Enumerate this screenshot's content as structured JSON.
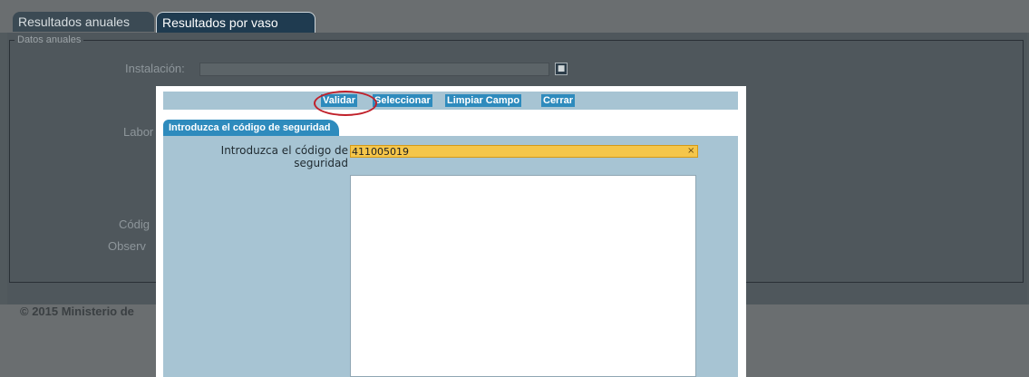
{
  "tabs": [
    {
      "label": "Resultados anuales",
      "active": false
    },
    {
      "label": "Resultados por vaso",
      "active": true
    }
  ],
  "form": {
    "legend": "Datos anuales",
    "labels": {
      "instalacion": "Instalación:",
      "laboratorio": "Labor",
      "codigo": "Códig",
      "observaciones": "Observ"
    },
    "instalacion_value": ""
  },
  "footer": {
    "text": "© 2015 Ministerio de"
  },
  "modal": {
    "toolbar": {
      "validar": "Validar",
      "seleccionar": "Seleccionar",
      "limpiar": "Limpiar Campo",
      "cerrar": "Cerrar"
    },
    "tab": "Introduzca el código de seguridad",
    "field_label": "Introduzca el código de seguridad",
    "field_value": "411005019",
    "clear_glyph": "×",
    "textarea_value": ""
  },
  "colors": {
    "background": "#525a5e",
    "modal_accent": "#2e8bbd",
    "modal_panel": "#a7c4d3",
    "highlight_field": "#f5c64a",
    "annotation_circle": "#c0202a"
  }
}
